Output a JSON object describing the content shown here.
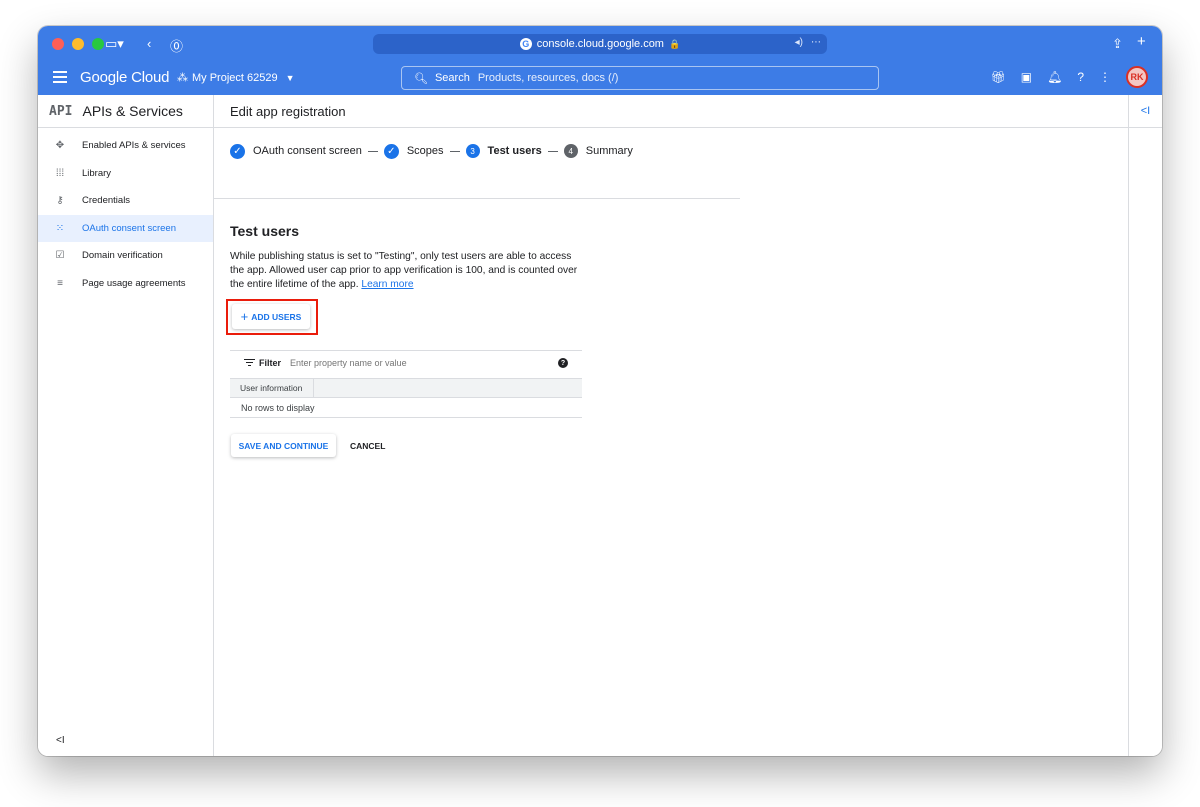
{
  "browser": {
    "url": "console.cloud.google.com",
    "favicon_letter": "G"
  },
  "header": {
    "logo": "Google Cloud",
    "project": "My Project 62529",
    "search_label": "Search",
    "search_placeholder": "Products, resources, docs (/)",
    "avatar_initials": "RK"
  },
  "sidebar": {
    "badge": "API",
    "title": "APIs & Services",
    "items": [
      {
        "label": "Enabled APIs & services",
        "icon": "api-hub-icon"
      },
      {
        "label": "Library",
        "icon": "library-grid-icon"
      },
      {
        "label": "Credentials",
        "icon": "key-icon"
      },
      {
        "label": "OAuth consent screen",
        "icon": "consent-dots-icon",
        "active": true
      },
      {
        "label": "Domain verification",
        "icon": "checkbox-icon"
      },
      {
        "label": "Page usage agreements",
        "icon": "agreement-list-icon"
      }
    ]
  },
  "main": {
    "page_title": "Edit app registration",
    "steps": [
      {
        "label": "OAuth consent screen",
        "state": "done"
      },
      {
        "label": "Scopes",
        "state": "done"
      },
      {
        "label": "Test users",
        "state": "current",
        "number": "3"
      },
      {
        "label": "Summary",
        "state": "todo",
        "number": "4"
      }
    ],
    "section_title": "Test users",
    "description": "While publishing status is set to \"Testing\", only test users are able to access the app. Allowed user cap prior to app verification is 100, and is counted over the entire lifetime of the app.",
    "learn_more": "Learn more",
    "add_users": "ADD USERS",
    "filter": {
      "label": "Filter",
      "placeholder": "Enter property name or value"
    },
    "table": {
      "columns": [
        "User information"
      ],
      "empty_text": "No rows to display"
    },
    "save_continue": "SAVE AND CONTINUE",
    "cancel": "CANCEL"
  },
  "colors": {
    "chrome_blue": "#3d7ce6",
    "accent": "#1a73e8",
    "highlight_frame": "#ea1c0b"
  }
}
